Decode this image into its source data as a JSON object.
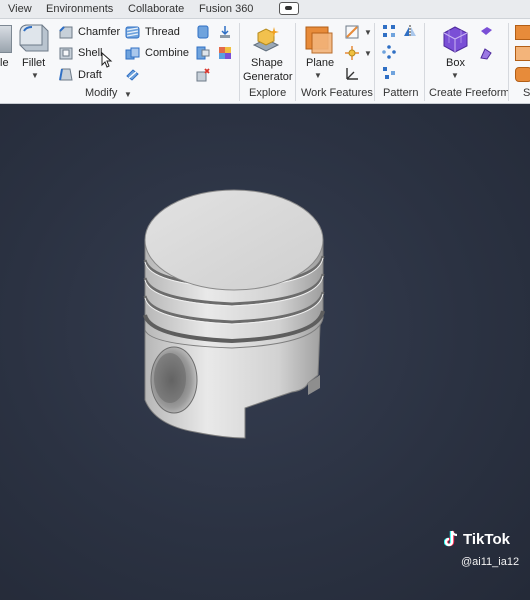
{
  "menu": {
    "tabs": [
      "View",
      "Environments",
      "Collaborate",
      "Fusion 360"
    ]
  },
  "modify": {
    "fillet_left_label": "le",
    "fillet_label": "Fillet",
    "chamfer_label": "Chamfer",
    "shell_label": "Shell",
    "draft_label": "Draft",
    "thread_label": "Thread",
    "combine_label": "Combine",
    "panel_title": "Modify"
  },
  "explore": {
    "shape_generator_label_line1": "Shape",
    "shape_generator_label_line2": "Generator",
    "panel_title": "Explore"
  },
  "work_features": {
    "plane_label": "Plane",
    "panel_title": "Work Features"
  },
  "pattern": {
    "panel_title": "Pattern"
  },
  "create_freeform": {
    "box_label": "Box",
    "panel_title": "Create Freeform",
    "next_panel_title_fragment": "S"
  },
  "watermark": {
    "brand": "TikTok",
    "handle": "@ai11_ia12"
  },
  "colors": {
    "viewport_bg": "#2b3242",
    "ribbon_bg": "#f7f8fa",
    "accent_blue": "#2f6fc4",
    "freeform_purple": "#7a4fd6",
    "plane_orange": "#e78b3a"
  }
}
